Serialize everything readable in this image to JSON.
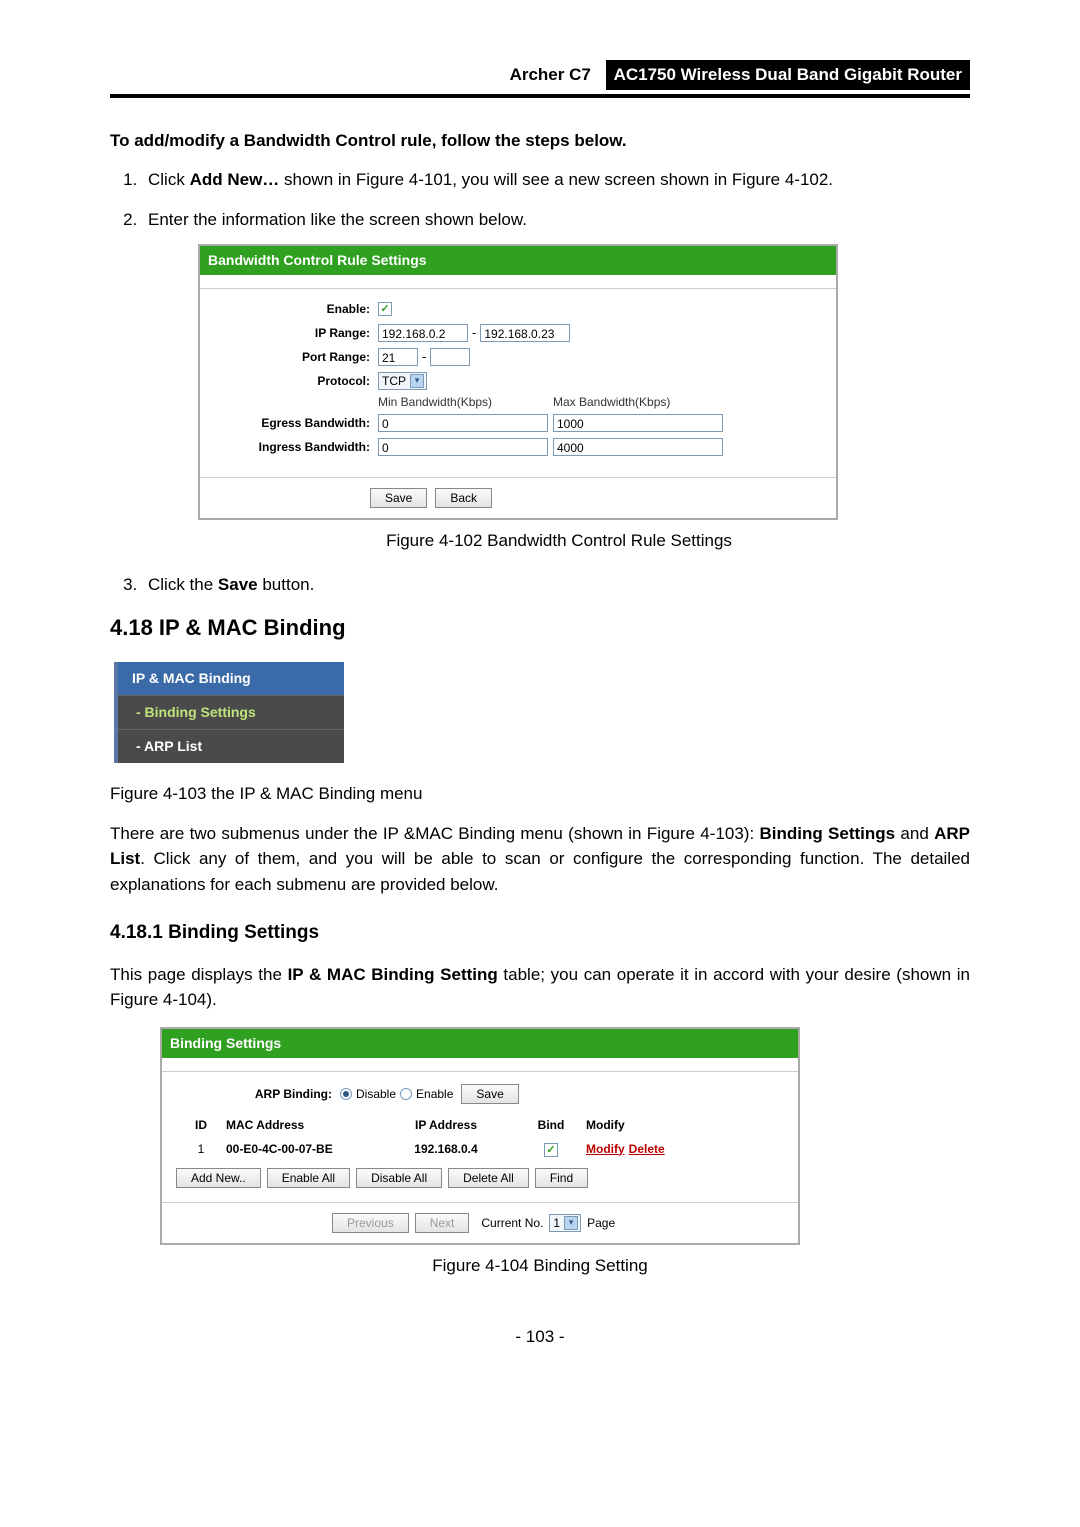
{
  "header": {
    "model": "Archer C7",
    "description": "AC1750 Wireless Dual Band Gigabit Router"
  },
  "intro": "To add/modify a Bandwidth Control rule, follow the steps below.",
  "steps": {
    "s1_pre": "Click ",
    "s1_bold": "Add New…",
    "s1_post": " shown in Figure 4-101, you will see a new screen shown in Figure 4-102.",
    "s2": "Enter the information like the screen shown below.",
    "s3_pre": "Click the ",
    "s3_bold": "Save",
    "s3_post": " button."
  },
  "panel1": {
    "title": "Bandwidth Control Rule Settings",
    "labels": {
      "enable": "Enable:",
      "iprange": "IP Range:",
      "portrange": "Port Range:",
      "protocol": "Protocol:",
      "egress": "Egress Bandwidth:",
      "ingress": "Ingress Bandwidth:"
    },
    "values": {
      "ip_from": "192.168.0.2",
      "ip_to": "192.168.0.23",
      "port_from": "21",
      "port_to": "",
      "protocol": "TCP",
      "min_col": "Min Bandwidth(Kbps)",
      "max_col": "Max Bandwidth(Kbps)",
      "eg_min": "0",
      "eg_max": "1000",
      "in_min": "0",
      "in_max": "4000"
    },
    "buttons": {
      "save": "Save",
      "back": "Back"
    }
  },
  "caption1": "Figure 4-102 Bandwidth Control Rule Settings",
  "section_h2": "4.18  IP & MAC Binding",
  "sidemenu": {
    "title": "IP & MAC Binding",
    "item1": "- Binding Settings",
    "item2": "- ARP List"
  },
  "caption2": "Figure 4-103 the IP & MAC Binding menu",
  "para1_a": "There are two submenus under the IP &MAC Binding menu (shown in Figure 4-103): ",
  "para1_b1": "Binding Settings",
  "para1_mid": " and ",
  "para1_b2": "ARP List",
  "para1_c": ". Click any of them, and you will be able to scan or configure the corresponding function. The detailed explanations for each submenu are provided below.",
  "section_h3": "4.18.1    Binding Settings",
  "para2_a": "This page displays the ",
  "para2_b": "IP & MAC Binding Setting",
  "para2_c": " table; you can operate it in accord with your desire (shown in Figure 4-104).",
  "panel2": {
    "title": "Binding Settings",
    "arp_label": "ARP Binding:",
    "disable": "Disable",
    "enable": "Enable",
    "save": "Save",
    "cols": {
      "id": "ID",
      "mac": "MAC Address",
      "ip": "IP Address",
      "bind": "Bind",
      "mod": "Modify"
    },
    "row": {
      "id": "1",
      "mac": "00-E0-4C-00-07-BE",
      "ip": "192.168.0.4",
      "modify": "Modify",
      "delete": "Delete"
    },
    "btns": {
      "addnew": "Add New..",
      "enableall": "Enable All",
      "disableall": "Disable All",
      "deleteall": "Delete All",
      "find": "Find"
    },
    "pager": {
      "prev": "Previous",
      "next": "Next",
      "curlabel": "Current No.",
      "cur": "1",
      "page": "Page"
    }
  },
  "caption3": "Figure 4-104 Binding Setting",
  "pagenum": "- 103 -"
}
